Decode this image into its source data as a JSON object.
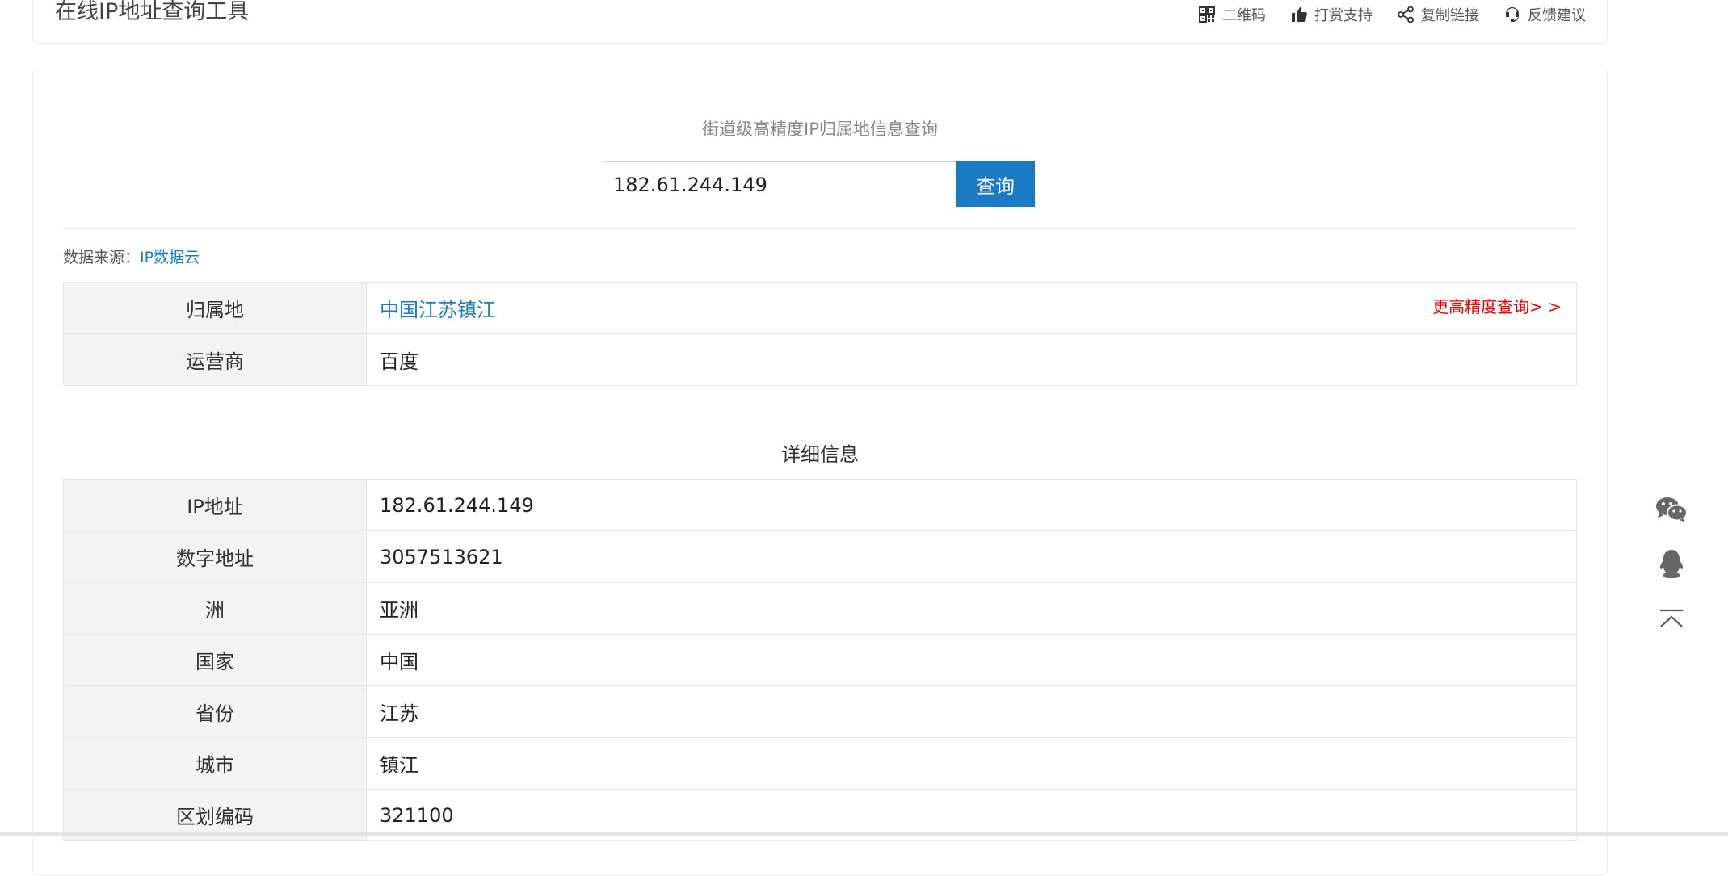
{
  "header": {
    "title": "在线IP地址查询工具",
    "actions": [
      {
        "label": "二维码",
        "icon": "qrcode-icon"
      },
      {
        "label": "打赏支持",
        "icon": "thumbs-up-icon"
      },
      {
        "label": "复制链接",
        "icon": "share-icon"
      },
      {
        "label": "反馈建议",
        "icon": "headset-icon"
      }
    ]
  },
  "search": {
    "tagline": "街道级高精度IP归属地信息查询",
    "value": "182.61.244.149",
    "button_label": "查询"
  },
  "source": {
    "label": "数据来源：",
    "link": "IP数据云"
  },
  "summary": {
    "rows": [
      {
        "key": "归属地",
        "value": "中国江苏镇江",
        "more": "更高精度查询> >"
      },
      {
        "key": "运营商",
        "value": "百度"
      }
    ]
  },
  "details": {
    "title": "详细信息",
    "rows": [
      {
        "key": "IP地址",
        "value": "182.61.244.149"
      },
      {
        "key": "数字地址",
        "value": "3057513621"
      },
      {
        "key": "洲",
        "value": "亚洲"
      },
      {
        "key": "国家",
        "value": "中国"
      },
      {
        "key": "省份",
        "value": "江苏"
      },
      {
        "key": "城市",
        "value": "镇江"
      },
      {
        "key": "区划编码",
        "value": "321100"
      }
    ]
  },
  "side_tools": [
    "wechat-icon",
    "qq-icon",
    "back-to-top-icon"
  ],
  "colors": {
    "accent": "#1a7ac4",
    "link_red": "#e60000",
    "key_bg": "#f3f3f3"
  }
}
